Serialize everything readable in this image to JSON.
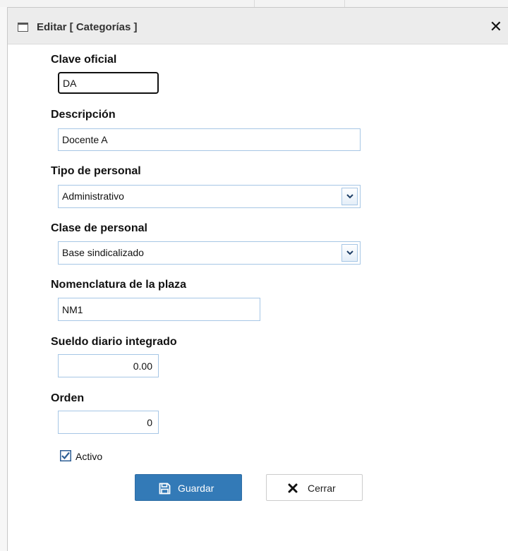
{
  "window": {
    "title": "Editar [ Categorías ]"
  },
  "fields": {
    "clave": {
      "label": "Clave oficial",
      "value": "DA"
    },
    "descripcion": {
      "label": "Descripción",
      "value": "Docente A"
    },
    "tipo": {
      "label": "Tipo de personal",
      "value": "Administrativo"
    },
    "clase": {
      "label": "Clase de personal",
      "value": "Base sindicalizado"
    },
    "nomenclatura": {
      "label": "Nomenclatura de la plaza",
      "value": "NM1"
    },
    "sueldo": {
      "label": "Sueldo diario integrado",
      "value": "0.00"
    },
    "orden": {
      "label": "Orden",
      "value": "0"
    }
  },
  "activo": {
    "label": "Activo",
    "checked": true
  },
  "buttons": {
    "save": "Guardar",
    "close": "Cerrar"
  },
  "colors": {
    "primary": "#337ab7",
    "field_border": "#a6c6e5",
    "titlebar": "#ececec"
  },
  "icons": {
    "window": "window-icon",
    "close": "close-icon",
    "save": "floppy-disk-icon",
    "cancel": "x-icon",
    "dropdown": "chevron-down-icon",
    "checkbox": "checkbox-checked-icon"
  }
}
